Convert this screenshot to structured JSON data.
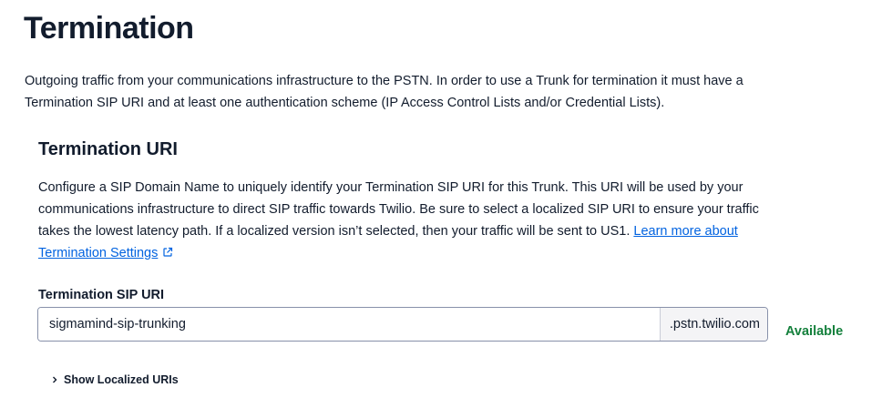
{
  "page": {
    "title": "Termination",
    "intro": "Outgoing traffic from your communications infrastructure to the PSTN. In order to use a Trunk for termination it must have a Termination SIP URI and at least one authentication scheme (IP Access Control Lists and/or Credential Lists)."
  },
  "termination_uri": {
    "heading": "Termination URI",
    "description": "Configure a SIP Domain Name to uniquely identify your Termination SIP URI for this Trunk. This URI will be used by your communications infrastructure to direct SIP traffic towards Twilio. Be sure to select a localized SIP URI to ensure your traffic takes the lowest latency path. If a localized version isn’t selected, then your traffic will be sent to US1. ",
    "learn_more_link": "Learn more about Termination Settings",
    "field_label": "Termination SIP URI",
    "field_value": "sigmamind-sip-trunking",
    "field_suffix": ".pstn.twilio.com",
    "availability_status": "Available",
    "show_localized_label": "Show Localized URIs"
  },
  "colors": {
    "link": "#0263e0",
    "status_available": "#14803c",
    "text": "#121c2d"
  },
  "icons": {
    "external_link": "external-link-icon",
    "disclosure": "chevron-right-icon"
  }
}
